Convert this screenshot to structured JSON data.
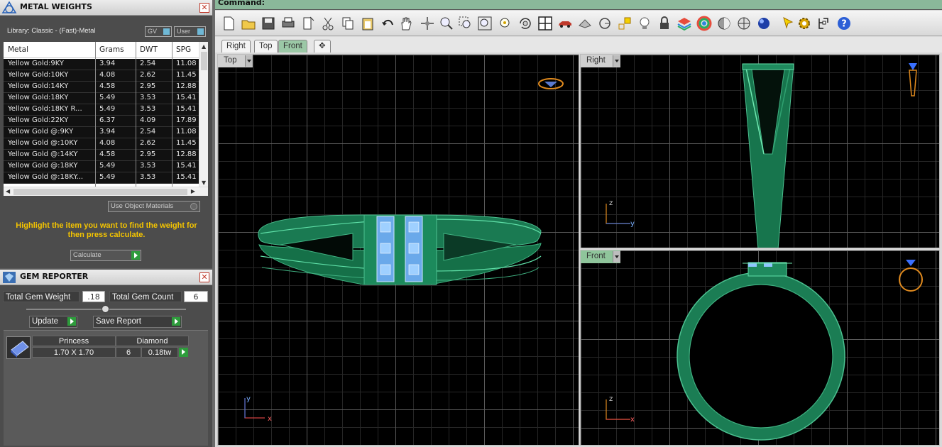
{
  "metal_weights": {
    "title": "METAL WEIGHTS",
    "library_label": "Library: Classic - (Fast)-Metal",
    "toggle_gv": "GV",
    "toggle_user": "User",
    "columns": [
      "Metal",
      "Grams",
      "DWT",
      "SPG"
    ],
    "rows": [
      [
        "Yellow Gold:9KY",
        "3.94",
        "2.54",
        "11.08"
      ],
      [
        "Yellow Gold:10KY",
        "4.08",
        "2.62",
        "11.45"
      ],
      [
        "Yellow Gold:14KY",
        "4.58",
        "2.95",
        "12.88"
      ],
      [
        "Yellow Gold:18KY",
        "5.49",
        "3.53",
        "15.41"
      ],
      [
        "Yellow Gold:18KY R...",
        "5.49",
        "3.53",
        "15.41"
      ],
      [
        "Yellow Gold:22KY",
        "6.37",
        "4.09",
        "17.89"
      ],
      [
        "Yellow Gold @:9KY",
        "3.94",
        "2.54",
        "11.08"
      ],
      [
        "Yellow Gold @:10KY",
        "4.08",
        "2.62",
        "11.45"
      ],
      [
        "Yellow Gold @:14KY",
        "4.58",
        "2.95",
        "12.88"
      ],
      [
        "Yellow Gold @:18KY",
        "5.49",
        "3.53",
        "15.41"
      ],
      [
        "Yellow Gold @:18KY...",
        "5.49",
        "3.53",
        "15.41"
      ]
    ],
    "use_object_materials": "Use Object Materials",
    "hint": "Highlight the item you want to find the weight for then press calculate.",
    "calculate_label": "Calculate"
  },
  "gem_reporter": {
    "title": "GEM REPORTER",
    "total_weight_label": "Total Gem Weight",
    "total_weight_value": ".18",
    "total_count_label": "Total Gem Count",
    "total_count_value": "6",
    "update_label": "Update",
    "save_report_label": "Save Report",
    "gem": {
      "cut": "Princess",
      "material": "Diamond",
      "size": "1.70 X 1.70",
      "count": "6",
      "weight": "0.18tw"
    }
  },
  "command": {
    "label": "Command:"
  },
  "toolbar_icons": [
    "new-icon",
    "open-icon",
    "save-icon",
    "print-icon",
    "properties-icon",
    "cut-icon",
    "copy-icon",
    "paste-icon",
    "undo-icon",
    "pan-hand-icon",
    "move-icon",
    "zoom-icon",
    "zoom-window-icon",
    "zoom-extents-icon",
    "zoom-selected-icon",
    "rotate-view-icon",
    "viewport-layout-icon",
    "car-icon",
    "plane-icon",
    "circle-icon",
    "snap-icon",
    "lightbulb-icon",
    "lock-icon",
    "layers-icon",
    "color-wheel-icon",
    "shade-icon",
    "render-icon",
    "sphere-icon",
    "cursor-icon",
    "gear-icon",
    "tree-icon",
    "help-icon"
  ],
  "view_tabs": [
    "Right",
    "Top",
    "Front"
  ],
  "active_tab": "Front",
  "viewports": {
    "top": "Top",
    "right": "Right",
    "front": "Front"
  },
  "colors": {
    "model_green": "#1f8a5e",
    "gem_blue": "#7fb6f0",
    "grid_major": "#5a5a5a",
    "grid_minor": "#262626",
    "active_tab": "#9bc8a6",
    "hint_yellow": "#f4c400"
  }
}
